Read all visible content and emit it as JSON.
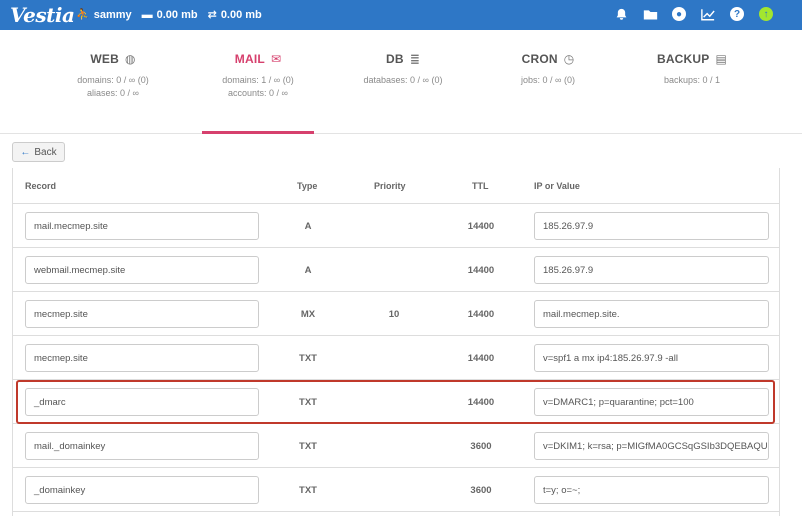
{
  "topbar": {
    "logo": "Vestia",
    "user": "sammy",
    "disk": "0.00 mb",
    "bandwidth": "0.00 mb",
    "icons": [
      "bell-icon",
      "folder-icon",
      "user-icon",
      "chart-icon",
      "help-icon",
      "update-icon"
    ],
    "color": "#2e77c6"
  },
  "tabs": [
    {
      "name": "WEB",
      "icon": "globe-icon",
      "glyph": "◍",
      "line1": "domains: 0 / ∞ (0)",
      "line2": "aliases: 0 / ∞"
    },
    {
      "name": "MAIL",
      "icon": "mail-icon",
      "glyph": "✉",
      "line1": "domains: 1 / ∞ (0)",
      "line2": "accounts: 0 / ∞",
      "active": true
    },
    {
      "name": "DB",
      "icon": "database-icon",
      "glyph": "≣",
      "line1": "databases: 0 / ∞ (0)",
      "line2": ""
    },
    {
      "name": "CRON",
      "icon": "clock-icon",
      "glyph": "◷",
      "line1": "jobs: 0 / ∞ (0)",
      "line2": ""
    },
    {
      "name": "BACKUP",
      "icon": "file-icon",
      "glyph": "▤",
      "line1": "backups: 0 / 1",
      "line2": ""
    }
  ],
  "accent": "#d6406d",
  "back_label": "Back",
  "table": {
    "headers": {
      "record": "Record",
      "type": "Type",
      "priority": "Priority",
      "ttl": "TTL",
      "value": "IP or Value"
    },
    "rows": [
      {
        "record": "mail.mecmep.site",
        "type": "A",
        "priority": "",
        "ttl": "14400",
        "value": "185.26.97.9"
      },
      {
        "record": "webmail.mecmep.site",
        "type": "A",
        "priority": "",
        "ttl": "14400",
        "value": "185.26.97.9"
      },
      {
        "record": "mecmep.site",
        "type": "MX",
        "priority": "10",
        "ttl": "14400",
        "value": "mail.mecmep.site."
      },
      {
        "record": "mecmep.site",
        "type": "TXT",
        "priority": "",
        "ttl": "14400",
        "value": "v=spf1 a mx ip4:185.26.97.9 -all"
      },
      {
        "record": "_dmarc",
        "type": "TXT",
        "priority": "",
        "ttl": "14400",
        "value": "v=DMARC1; p=quarantine; pct=100"
      },
      {
        "record": "mail._domainkey",
        "type": "TXT",
        "priority": "",
        "ttl": "3600",
        "value": "v=DKIM1; k=rsa; p=MIGfMA0GCSqGSIb3DQEBAQU"
      },
      {
        "record": "_domainkey",
        "type": "TXT",
        "priority": "",
        "ttl": "3600",
        "value": "t=y; o=~;"
      }
    ]
  },
  "highlight_color": "#c0392b"
}
